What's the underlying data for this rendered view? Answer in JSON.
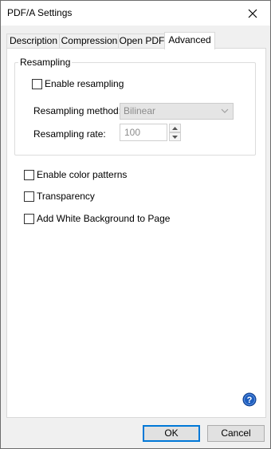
{
  "window": {
    "title": "PDF/A Settings"
  },
  "tabs": [
    {
      "label": "Description",
      "active": false
    },
    {
      "label": "Compression",
      "active": false
    },
    {
      "label": "Open PDF",
      "active": false
    },
    {
      "label": "Advanced",
      "active": true
    }
  ],
  "resampling": {
    "group_label": "Resampling",
    "enable_label": "Enable resampling",
    "enable_checked": false,
    "method_label": "Resampling method:",
    "method_value": "Bilinear",
    "rate_label": "Resampling rate:",
    "rate_value": "100"
  },
  "options": [
    {
      "label": "Enable color patterns",
      "checked": false
    },
    {
      "label": "Transparency",
      "checked": false
    },
    {
      "label": "Add White Background to Page",
      "checked": false
    }
  ],
  "buttons": {
    "ok": "OK",
    "cancel": "Cancel"
  },
  "colors": {
    "accent": "#0078d7",
    "help": "#1f5fbf",
    "disabled_text": "#8c8c8c"
  },
  "icons": {
    "close": "close-icon",
    "help": "help-icon",
    "chevron": "chevron-down-icon"
  }
}
